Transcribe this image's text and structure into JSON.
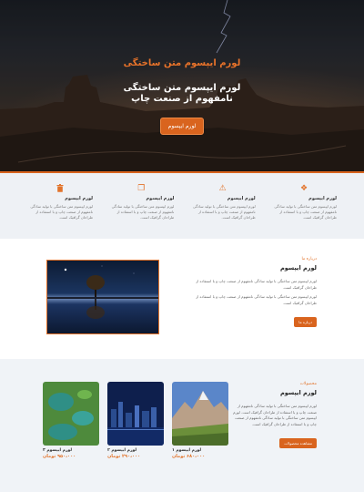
{
  "hero": {
    "title": "لورم ایپسوم متن ساختگی",
    "subtitle": "لورم ایپسوم متن ساختگی نامفهوم از صنعت چاپ",
    "button_label": "لورم ایپسوم"
  },
  "features": [
    {
      "icon": "diamond-icon",
      "glyph": "❖",
      "title": "لورم ایپسوم",
      "text": "لورم ایپسوم متن ساختگی با تولید سادگی نامفهوم از صنعت چاپ و با استفاده از طراحان گرافیک است."
    },
    {
      "icon": "warning-icon",
      "glyph": "⚠",
      "title": "لورم ایپسوم",
      "text": "لورم ایپسوم متن ساختگی با تولید سادگی نامفهوم از صنعت چاپ و با استفاده از طراحان گرافیک است."
    },
    {
      "icon": "copy-icon",
      "glyph": "❐",
      "title": "لورم ایپسوم",
      "text": "لورم ایپسوم متن ساختگی با تولید سادگی نامفهوم از صنعت چاپ و با استفاده از طراحان گرافیک است."
    },
    {
      "icon": "trash-icon",
      "glyph": "🗑",
      "title": "لورم ایپسوم",
      "text": "لورم ایپسوم متن ساختگی با تولید سادگی نامفهوم از صنعت چاپ و با استفاده از طراحان گرافیک است."
    }
  ],
  "about": {
    "kicker": "درباره ما",
    "title": "لورم ایپسوم",
    "para1": "لورم ایپسوم متن ساختگی با تولید سادگی نامفهوم از صنعت چاپ و با استفاده از طراحان گرافیک است.",
    "para2": "لورم ایپسوم متن ساختگی با تولید سادگی نامفهوم از صنعت چاپ و با استفاده از طراحان گرافیک است.",
    "button_label": "درباره ما"
  },
  "products": {
    "kicker": "محصولات",
    "title": "لورم ایپسوم",
    "text": "لورم ایپسوم متن ساختگی با تولید سادگی نامفهوم از صنعت چاپ و با استفاده از طراحان گرافیک است. لورم ایپسوم متن ساختگی با تولید سادگی نامفهوم از صنعت چاپ و با استفاده از طراحان گرافیک است.",
    "button_label": "مشاهده محصولات",
    "items": [
      {
        "name": "لورم ایپسوم ۱",
        "price": "۶۸۰،۰۰۰ تومان"
      },
      {
        "name": "لورم ایپسوم ۲",
        "price": "۲۹۰،۰۰۰ تومان"
      },
      {
        "name": "لورم ایپسوم ۳",
        "price": "۹۵۰،۰۰۰ تومان"
      }
    ]
  },
  "colors": {
    "accent": "#e2732a",
    "button": "#d9641e",
    "section_bg": "#eef1f5"
  }
}
